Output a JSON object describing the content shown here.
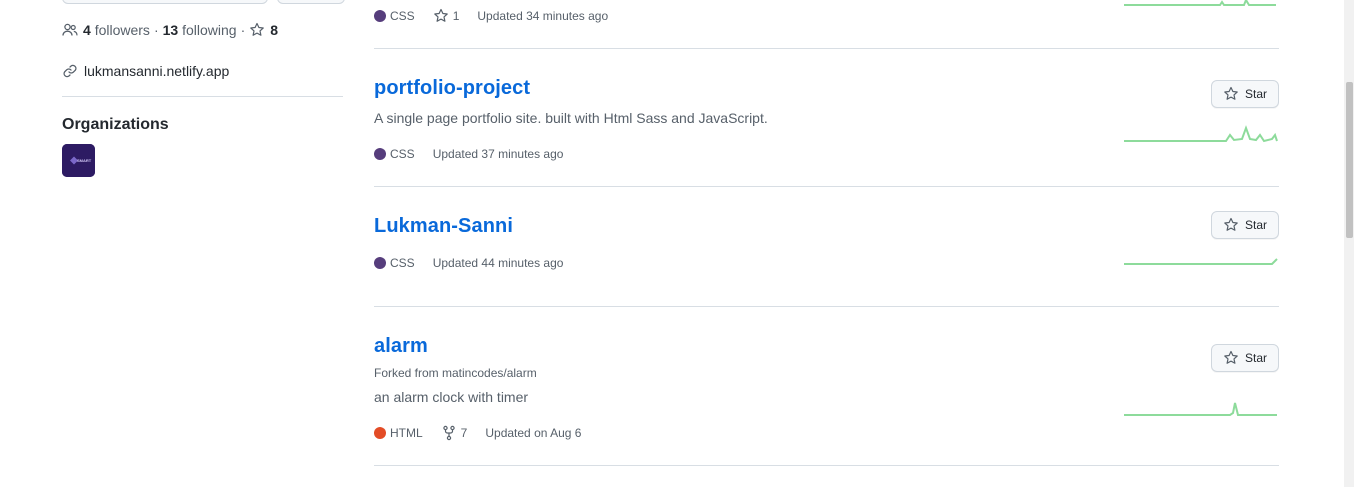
{
  "profile": {
    "followers_count": "4",
    "followers_label": "followers",
    "separator": "·",
    "following_count": "13",
    "following_label": "following",
    "stars_count": "8",
    "website": "lukmansanni.netlify.app"
  },
  "organizations": {
    "title": "Organizations",
    "items": [
      {
        "avatar_text": "SMART"
      }
    ]
  },
  "repos": [
    {
      "language": "CSS",
      "language_color": "#563d7c",
      "stars": "1",
      "updated": "Updated 34 minutes ago"
    },
    {
      "name": "portfolio-project",
      "description": "A single page portfolio site. built with Html Sass and JavaScript.",
      "language": "CSS",
      "language_color": "#563d7c",
      "updated": "Updated 37 minutes ago",
      "star_label": "Star"
    },
    {
      "name": "Lukman-Sanni",
      "language": "CSS",
      "language_color": "#563d7c",
      "updated": "Updated 44 minutes ago",
      "star_label": "Star"
    },
    {
      "name": "alarm",
      "forked_from": "Forked from matincodes/alarm",
      "description": "an alarm clock with timer",
      "language": "HTML",
      "language_color": "#e34c26",
      "forks": "7",
      "updated": "Updated on Aug 6",
      "star_label": "Star"
    }
  ],
  "colors": {
    "link": "#0969da",
    "sparkline": "#8ddb9b",
    "muted": "#57606a"
  }
}
